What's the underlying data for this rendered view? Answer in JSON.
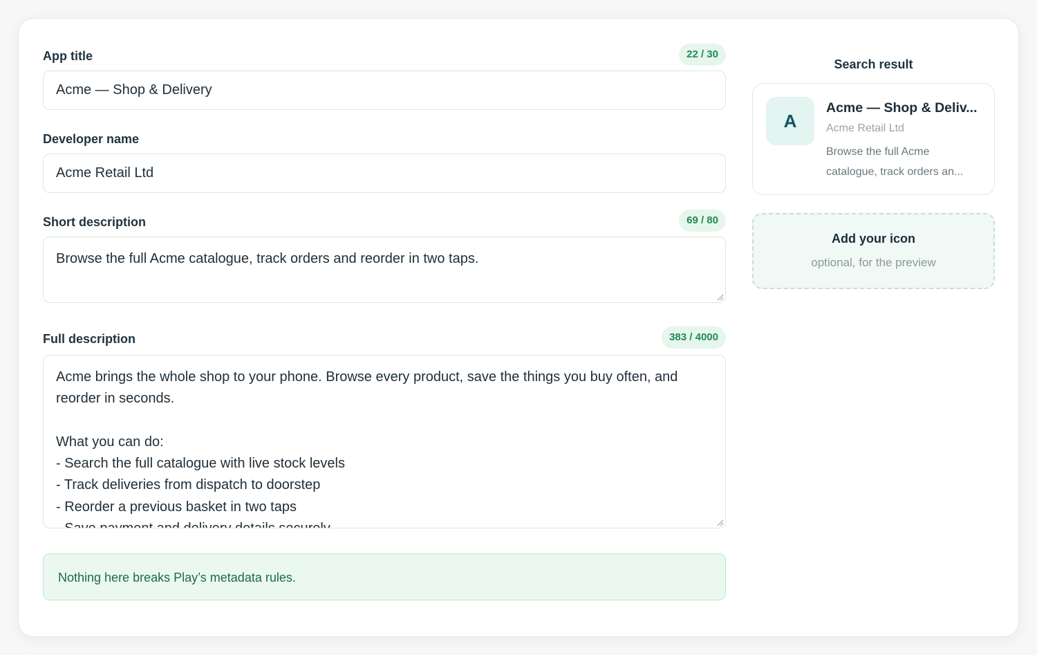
{
  "form": {
    "app_title": {
      "label": "App title",
      "counter": "22 / 30",
      "value": "Acme — Shop & Delivery"
    },
    "developer_name": {
      "label": "Developer name",
      "value": "Acme Retail Ltd"
    },
    "short_description": {
      "label": "Short description",
      "counter": "69 / 80",
      "value": "Browse the full Acme catalogue, track orders and reorder in two taps."
    },
    "full_description": {
      "label": "Full description",
      "counter": "383 / 4000",
      "value": "Acme brings the whole shop to your phone. Browse every product, save the things you buy often, and reorder in seconds.\n\nWhat you can do:\n- Search the full catalogue with live stock levels\n- Track deliveries from dispatch to doorstep\n- Reorder a previous basket in two taps\n- Save payment and delivery details securely"
    },
    "notice": "Nothing here breaks Play’s metadata rules."
  },
  "preview": {
    "title": "Search result",
    "icon_letter": "A",
    "result_title": "Acme — Shop & Deliv...",
    "result_developer": "Acme Retail Ltd",
    "result_desc_line1": "Browse the full Acme",
    "result_desc_line2": "catalogue, track orders an...",
    "dropzone_title": "Add your icon",
    "dropzone_subtitle": "optional, for the preview"
  },
  "colors": {
    "accent": "#1e8a55",
    "counter_bg": "#e6f6ec",
    "notice_bg": "#ebf8f0",
    "icon_bg": "#e4f4f0"
  }
}
